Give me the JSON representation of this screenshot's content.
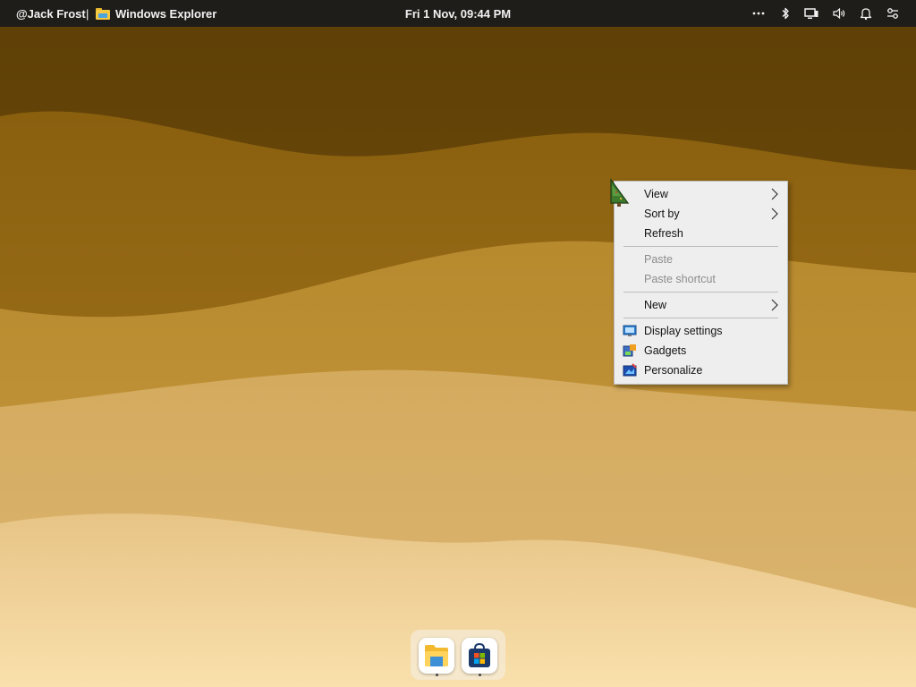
{
  "topbar": {
    "user": "@Jack Frost",
    "separator": "|",
    "active_app": "Windows Explorer",
    "clock": "Fri 1 Nov, 09:44 PM",
    "tray_icons": [
      "more-icon",
      "bluetooth-icon",
      "display-icon",
      "volume-icon",
      "notification-bell-icon",
      "settings-toggle-icon"
    ]
  },
  "context_menu": {
    "items": [
      {
        "label": "View",
        "submenu": true
      },
      {
        "label": "Sort by",
        "submenu": true
      },
      {
        "label": "Refresh"
      },
      {
        "label": "Paste",
        "disabled": true
      },
      {
        "label": "Paste shortcut",
        "disabled": true
      },
      {
        "label": "New",
        "submenu": true
      },
      {
        "label": "Display settings",
        "icon": "display-settings-icon"
      },
      {
        "label": "Gadgets",
        "icon": "gadgets-icon"
      },
      {
        "label": "Personalize",
        "icon": "personalize-icon"
      }
    ]
  },
  "dock": {
    "apps": [
      {
        "name": "File Explorer",
        "icon": "file-explorer-icon"
      },
      {
        "name": "Microsoft Store",
        "icon": "store-icon"
      }
    ]
  },
  "colors": {
    "topbar": "#1f1d1a",
    "wallpaper_dark": "#6b4806",
    "wallpaper_light": "#f8dfaa",
    "menu_bg": "#eeeeee"
  }
}
